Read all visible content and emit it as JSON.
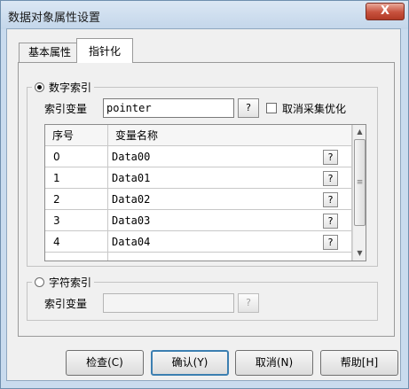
{
  "window": {
    "title": "数据对象属性设置",
    "close_label": "X"
  },
  "tabs": [
    {
      "label": "基本属性",
      "active": false
    },
    {
      "label": "指针化",
      "active": true
    }
  ],
  "numeric_index": {
    "radio_label": "数字索引",
    "selected": true,
    "var_label": "索引变量",
    "var_value": "pointer",
    "browse_label": "?",
    "cancel_collect_label": "取消采集优化",
    "cancel_collect_checked": false,
    "table": {
      "columns": [
        "序号",
        "变量名称"
      ],
      "rows": [
        {
          "index": "0",
          "name": "Data00"
        },
        {
          "index": "1",
          "name": "Data01"
        },
        {
          "index": "2",
          "name": "Data02"
        },
        {
          "index": "3",
          "name": "Data03"
        },
        {
          "index": "4",
          "name": "Data04"
        }
      ],
      "browse_label": "?"
    }
  },
  "char_index": {
    "radio_label": "字符索引",
    "selected": false,
    "var_label": "索引变量",
    "var_value": "",
    "browse_label": "?"
  },
  "buttons": {
    "check": "检查(C)",
    "ok": "确认(Y)",
    "cancel": "取消(N)",
    "help": "帮助[H]"
  }
}
